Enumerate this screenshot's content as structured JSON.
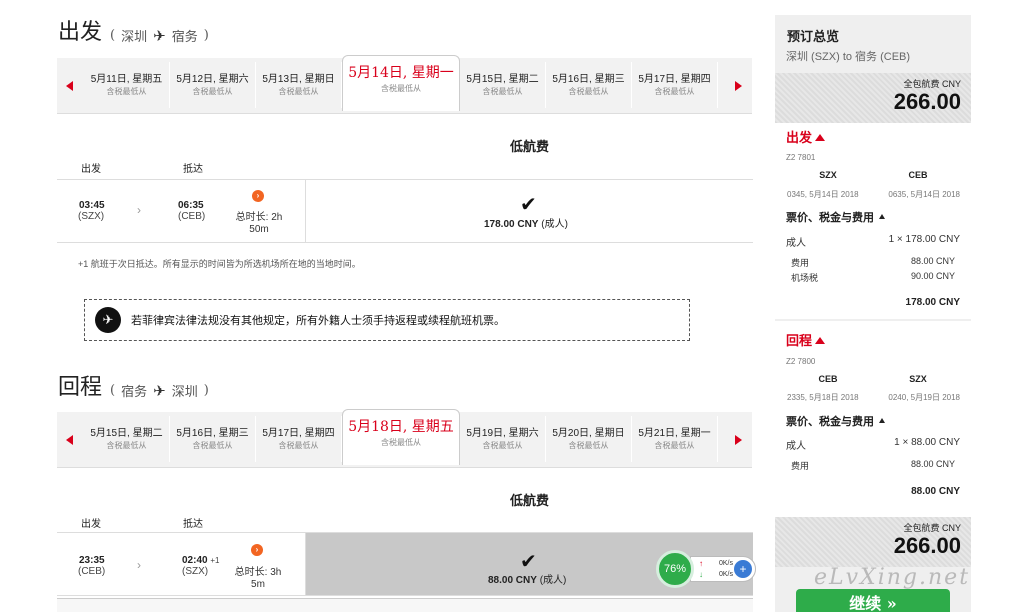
{
  "outbound": {
    "title": "出发",
    "from": "深圳",
    "to": "宿务",
    "dates": [
      {
        "date": "5月11日, 星期五",
        "price": "含税最低从"
      },
      {
        "date": "5月12日, 星期六",
        "price": "含税最低从"
      },
      {
        "date": "5月13日, 星期日",
        "price": "含税最低从"
      },
      {
        "date": "5月14日, 星期一",
        "price": "含税最低从"
      },
      {
        "date": "5月15日, 星期二",
        "price": "含税最低从"
      },
      {
        "date": "5月16日, 星期三",
        "price": "含税最低从"
      },
      {
        "date": "5月17日, 星期四",
        "price": "含税最低从"
      }
    ],
    "fare_header": "低航费",
    "col_depart": "出发",
    "col_arrive": "抵达",
    "flight": {
      "dep_time": "03:45",
      "dep_code": "(SZX)",
      "arr_time": "06:35",
      "arr_code": "(CEB)",
      "duration": "总时长: 2h",
      "duration2": "50m",
      "price": "178.00 CNY",
      "price_suffix": "(成人)"
    },
    "note": "+1 航班于次日抵达。所有显示的时间皆为所选机场所在地的当地时间。",
    "notice": "若菲律宾法律法规没有其他规定，所有外籍人士须手持返程或续程航班机票。"
  },
  "return": {
    "title": "回程",
    "from": "宿务",
    "to": "深圳",
    "dates": [
      {
        "date": "5月15日, 星期二",
        "price": "含税最低从"
      },
      {
        "date": "5月16日, 星期三",
        "price": "含税最低从"
      },
      {
        "date": "5月17日, 星期四",
        "price": "含税最低从"
      },
      {
        "date": "5月18日, 星期五",
        "price": "含税最低从"
      },
      {
        "date": "5月19日, 星期六",
        "price": "含税最低从"
      },
      {
        "date": "5月20日, 星期日",
        "price": "含税最低从"
      },
      {
        "date": "5月21日, 星期一",
        "price": "含税最低从"
      }
    ],
    "fare_header": "低航费",
    "col_depart": "出发",
    "col_arrive": "抵达",
    "flight": {
      "dep_time": "23:35",
      "dep_code": "(CEB)",
      "arr_time": "02:40",
      "arr_plus": "+1",
      "arr_code": "(SZX)",
      "duration": "总时长: 3h",
      "duration2": "5m",
      "price": "88.00 CNY",
      "price_suffix": "(成人)"
    }
  },
  "net_widget": {
    "percent": "76%",
    "up": "0K/s",
    "down": "0K/s"
  },
  "summary": {
    "title": "预订总览",
    "route": "深圳 (SZX) to 宿务 (CEB)",
    "total_label": "全包航费 CNY",
    "total": "266.00",
    "out": {
      "label": "出发",
      "flight_no": "Z2 7801",
      "from": "SZX",
      "to": "CEB",
      "dep_dt": "0345, 5月14日 2018",
      "arr_dt": "0635, 5月14日 2018",
      "fees_title": "票价、税金与费用",
      "adult_label": "成人",
      "adult_value": "1 × 178.00 CNY",
      "fee1_label": "费用",
      "fee1_value": "88.00 CNY",
      "fee2_label": "机场税",
      "fee2_value": "90.00 CNY",
      "subtotal": "178.00 CNY"
    },
    "ret": {
      "label": "回程",
      "flight_no": "Z2 7800",
      "from": "CEB",
      "to": "SZX",
      "dep_dt": "2335, 5月18日 2018",
      "arr_dt": "0240, 5月19日 2018",
      "fees_title": "票价、税金与费用",
      "adult_label": "成人",
      "adult_value": "1 × 88.00 CNY",
      "fee1_label": "费用",
      "fee1_value": "88.00 CNY",
      "subtotal": "88.00 CNY"
    },
    "total2_label": "全包航费 CNY",
    "total2": "266.00",
    "continue": "继续 »"
  },
  "watermark": "eLvXing.net",
  "colors": {
    "accent": "#d9001b",
    "go": "#2eac4a"
  }
}
